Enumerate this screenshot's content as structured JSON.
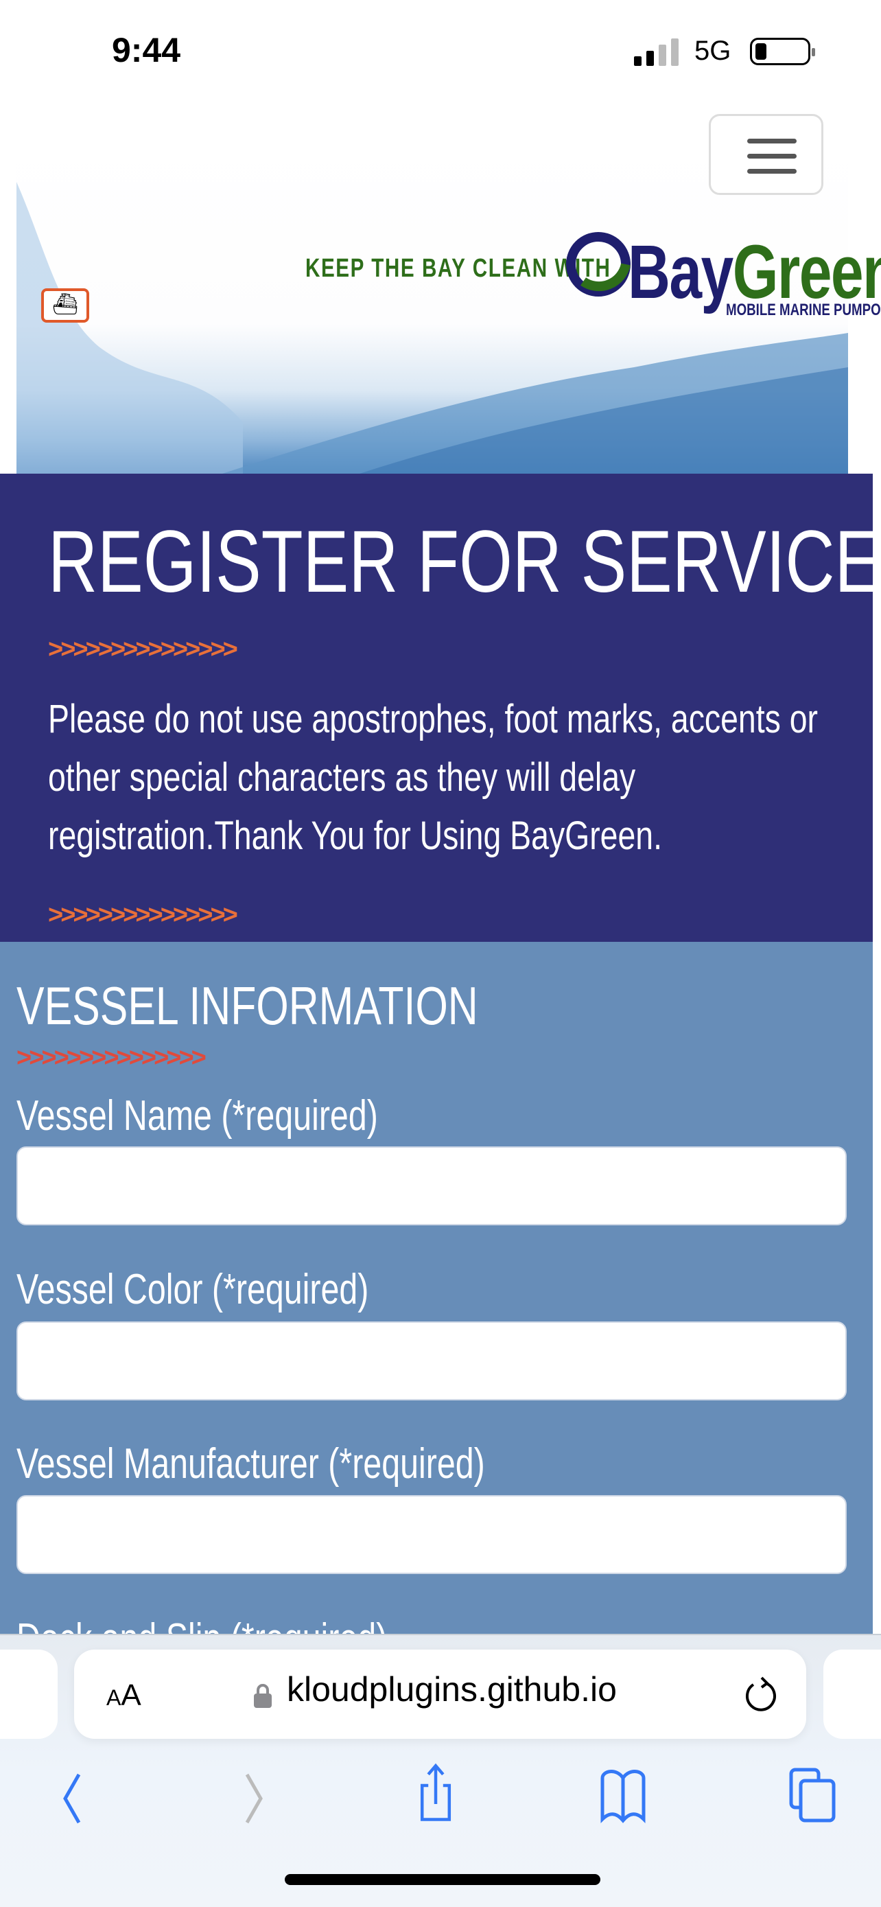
{
  "status_bar": {
    "time": "9:44",
    "network": "5G"
  },
  "header": {
    "menu_icon": "hamburger-icon"
  },
  "banner": {
    "tagline": "KEEP THE BAY CLEAN WITH",
    "brand_bay": "Bay",
    "brand_green": "Green",
    "brand_sub": "MOBILE MARINE PUMPOUT"
  },
  "hero": {
    "title": "REGISTER FOR SERVICE",
    "arrows": ">>>>>>>>>>>>>>>",
    "notice": "Please do not use apostrophes, foot marks, accents or other special characters as they will delay registration.Thank You for Using BayGreen."
  },
  "form": {
    "section_title": "VESSEL INFORMATION",
    "arrows": ">>>>>>>>>>>>>>>",
    "fields": [
      {
        "label": "Vessel Name (*required)",
        "value": ""
      },
      {
        "label": "Vessel Color (*required)",
        "value": ""
      },
      {
        "label": "Vessel Manufacturer (*required)",
        "value": ""
      },
      {
        "label": "Dock and Slip (*required)",
        "value": ""
      }
    ]
  },
  "browser": {
    "aa_small": "A",
    "aa_large": "A",
    "url": "kloudplugins.github.io"
  },
  "colors": {
    "hero_bg": "#2f2f77",
    "form_bg": "#678db8",
    "arrow_orange": "#e8703a",
    "arrow_red": "#e04a3c",
    "brand_navy": "#1e1e6e",
    "brand_green": "#2e6e1a",
    "ios_blue": "#3478f6"
  }
}
